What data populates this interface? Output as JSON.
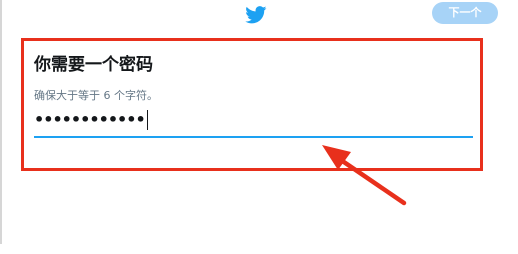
{
  "header": {
    "logo_icon": "twitter-bird-icon",
    "next_label": "下一个"
  },
  "form": {
    "title": "你需要一个密码",
    "hint": "确保大于等于 6 个字符。",
    "password_masked": "••••••••••••"
  },
  "colors": {
    "brand": "#1da1f2",
    "next_disabled": "#a7d3f7",
    "annotation": "#e8301c"
  }
}
